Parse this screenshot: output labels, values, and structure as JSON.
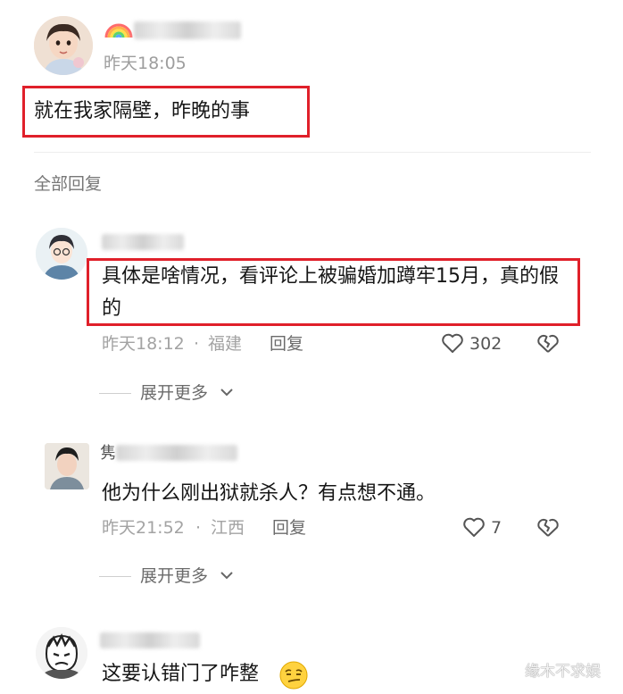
{
  "post": {
    "time": "昨天18:05",
    "text": "就在我家隔壁，昨晚的事"
  },
  "all_replies_label": "全部回复",
  "replies": [
    {
      "text": "具体是啥情况，看评论上被骗婚加蹲牢15月，真的假的",
      "time": "昨天18:12",
      "location": "福建",
      "reply_label": "回复",
      "likes": "302",
      "more_label": "展开更多"
    },
    {
      "name_char": "隽",
      "text": "他为什么刚出狱就杀人？有点想不通。",
      "time": "昨天21:52",
      "location": "江西",
      "reply_label": "回复",
      "likes": "7",
      "more_label": "展开更多"
    },
    {
      "text": "这要认错门了咋整"
    }
  ],
  "meta_separator": "·",
  "watermark": "缘木不求娱",
  "colors": {
    "highlight_border": "#e0202a",
    "secondary_text": "#a3a3a3",
    "watermark": "#f0f0f0"
  }
}
